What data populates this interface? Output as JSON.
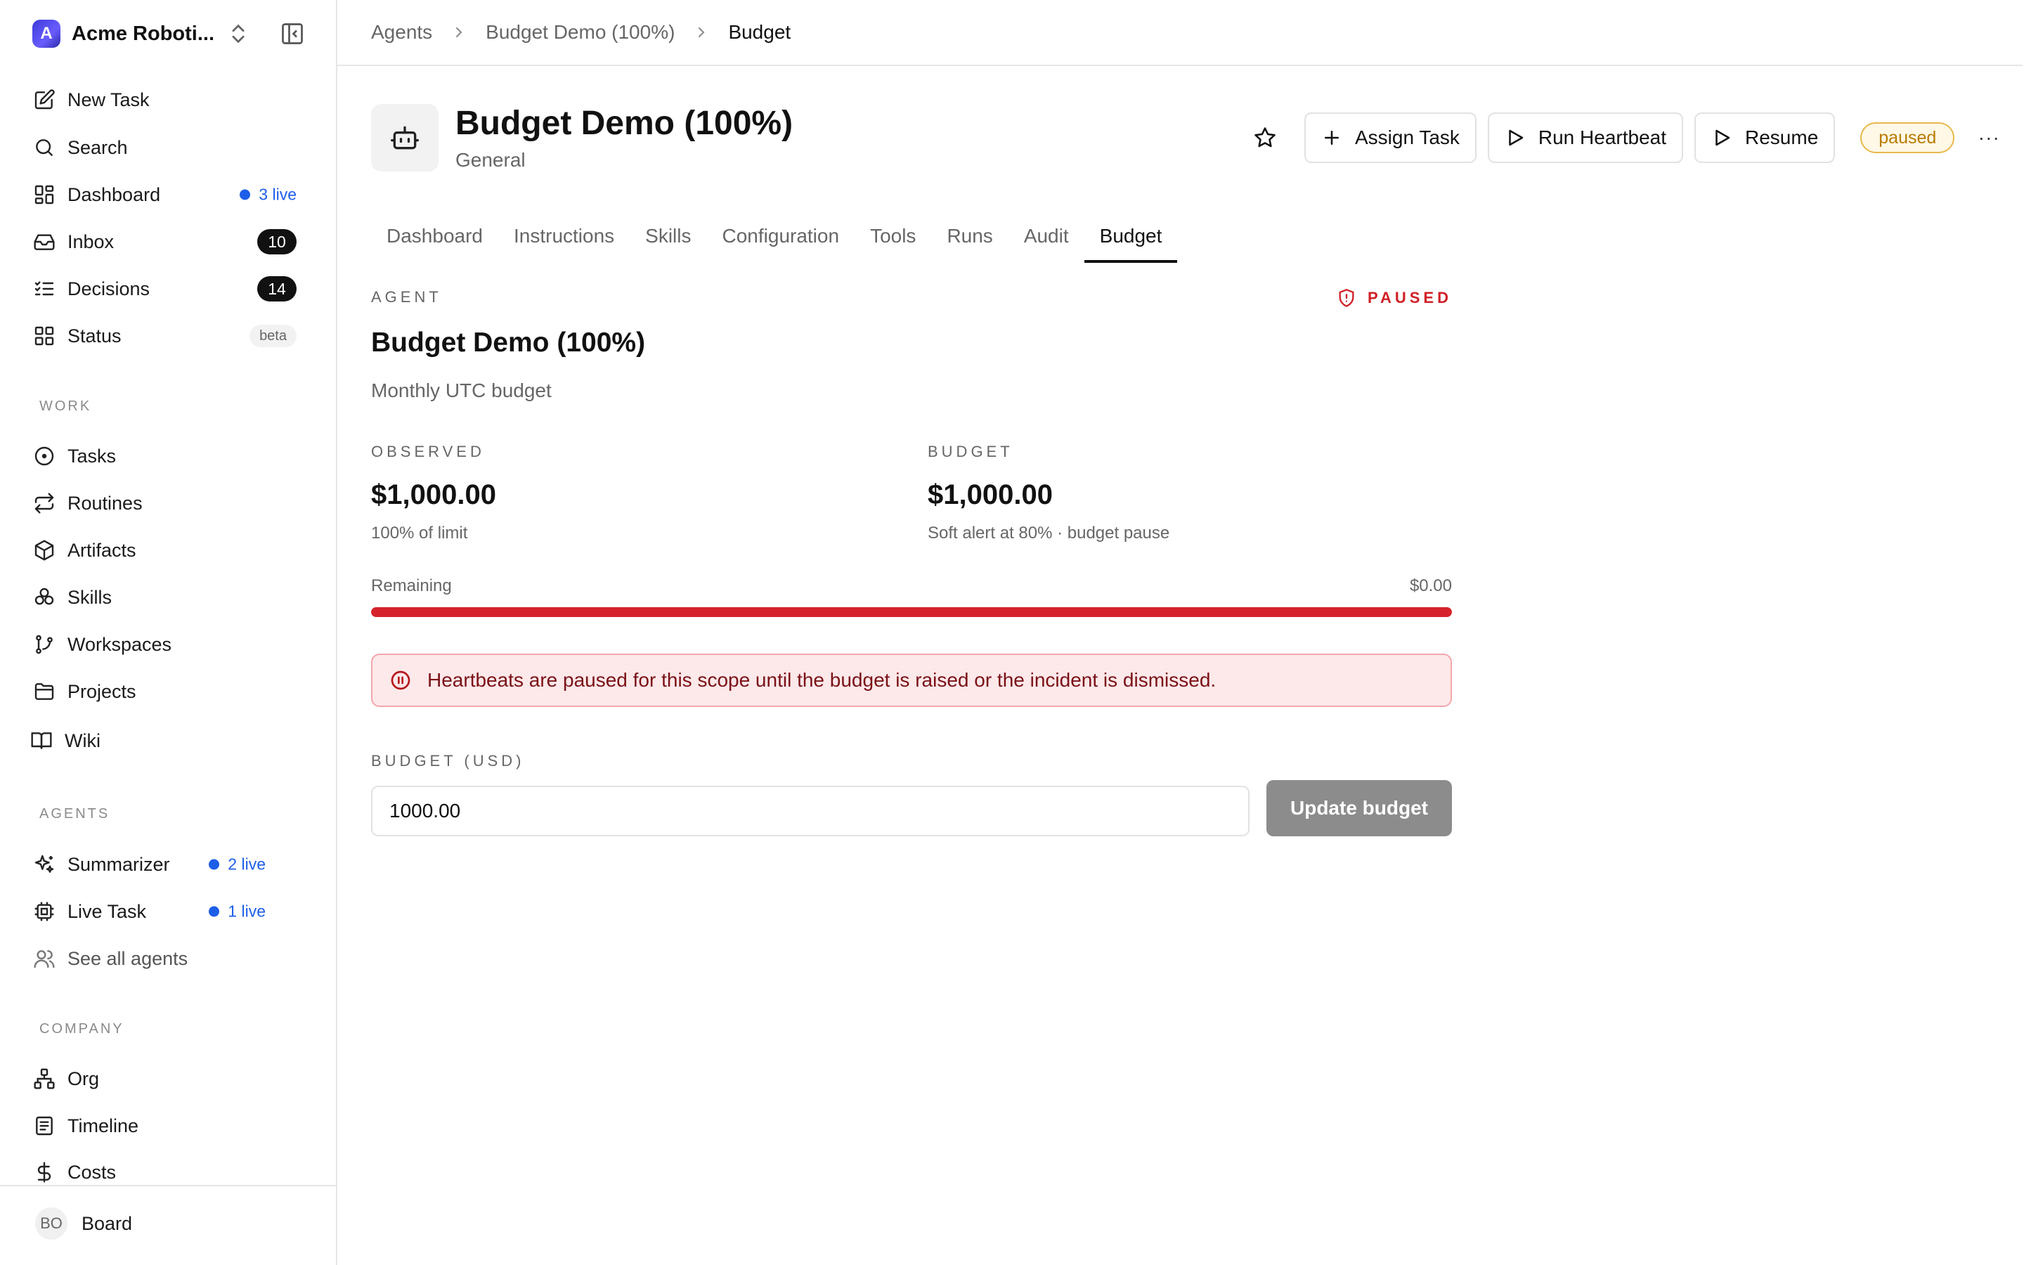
{
  "sidebar": {
    "company": "Acme Roboti...",
    "logo_letter": "A",
    "top_items": [
      {
        "label": "New Task",
        "icon": "edit-icon"
      },
      {
        "label": "Search",
        "icon": "search-icon"
      },
      {
        "label": "Dashboard",
        "icon": "dashboard-icon",
        "live": "3 live"
      },
      {
        "label": "Inbox",
        "icon": "inbox-icon",
        "count": "10"
      },
      {
        "label": "Decisions",
        "icon": "checklist-icon",
        "count": "14"
      },
      {
        "label": "Status",
        "icon": "grid-icon",
        "badge": "beta"
      }
    ],
    "work_title": "WORK",
    "work_items": [
      {
        "label": "Tasks",
        "icon": "circle-dot-icon"
      },
      {
        "label": "Routines",
        "icon": "repeat-icon"
      },
      {
        "label": "Artifacts",
        "icon": "package-icon"
      },
      {
        "label": "Skills",
        "icon": "boxes-icon"
      },
      {
        "label": "Workspaces",
        "icon": "git-branch-icon"
      },
      {
        "label": "Projects",
        "icon": "folder-icon"
      },
      {
        "label": "Wiki",
        "icon": "book-icon"
      }
    ],
    "agents_title": "AGENTS",
    "agent_items": [
      {
        "label": "Summarizer",
        "icon": "sparkles-icon",
        "live": "2 live"
      },
      {
        "label": "Live Task",
        "icon": "cpu-icon",
        "live": "1 live"
      },
      {
        "label": "See all agents",
        "icon": "users-icon"
      }
    ],
    "company_title": "COMPANY",
    "company_items": [
      {
        "label": "Org",
        "icon": "org-icon"
      },
      {
        "label": "Timeline",
        "icon": "timeline-icon"
      },
      {
        "label": "Costs",
        "icon": "dollar-icon"
      }
    ],
    "footer": {
      "avatar": "BO",
      "label": "Board"
    }
  },
  "breadcrumb": [
    "Agents",
    "Budget Demo (100%)",
    "Budget"
  ],
  "header": {
    "title": "Budget Demo (100%)",
    "subtitle": "General",
    "assign_label": "Assign Task",
    "heartbeat_label": "Run Heartbeat",
    "resume_label": "Resume",
    "status": "paused",
    "more": "···"
  },
  "tabs": [
    "Dashboard",
    "Instructions",
    "Skills",
    "Configuration",
    "Tools",
    "Runs",
    "Audit",
    "Budget"
  ],
  "active_tab": "Budget",
  "budget_panel": {
    "scope_label": "AGENT",
    "state": "PAUSED",
    "name": "Budget Demo (100%)",
    "period": "Monthly UTC budget",
    "observed_label": "OBSERVED",
    "observed_value": "$1,000.00",
    "observed_note": "100% of limit",
    "budget_label": "BUDGET",
    "budget_value": "$1,000.00",
    "budget_note": "Soft alert at 80% · budget pause",
    "remaining_label": "Remaining",
    "remaining_value": "$0.00",
    "usage_fraction": 1.0,
    "alert": "Heartbeats are paused for this scope until the budget is raised or the incident is dismissed.",
    "input_label": "BUDGET (USD)",
    "input_value": "1000.00",
    "update_label": "Update budget"
  },
  "colors": {
    "accent": "#1d5ee8",
    "danger": "#d6232b",
    "warning": "#e8b94a"
  }
}
